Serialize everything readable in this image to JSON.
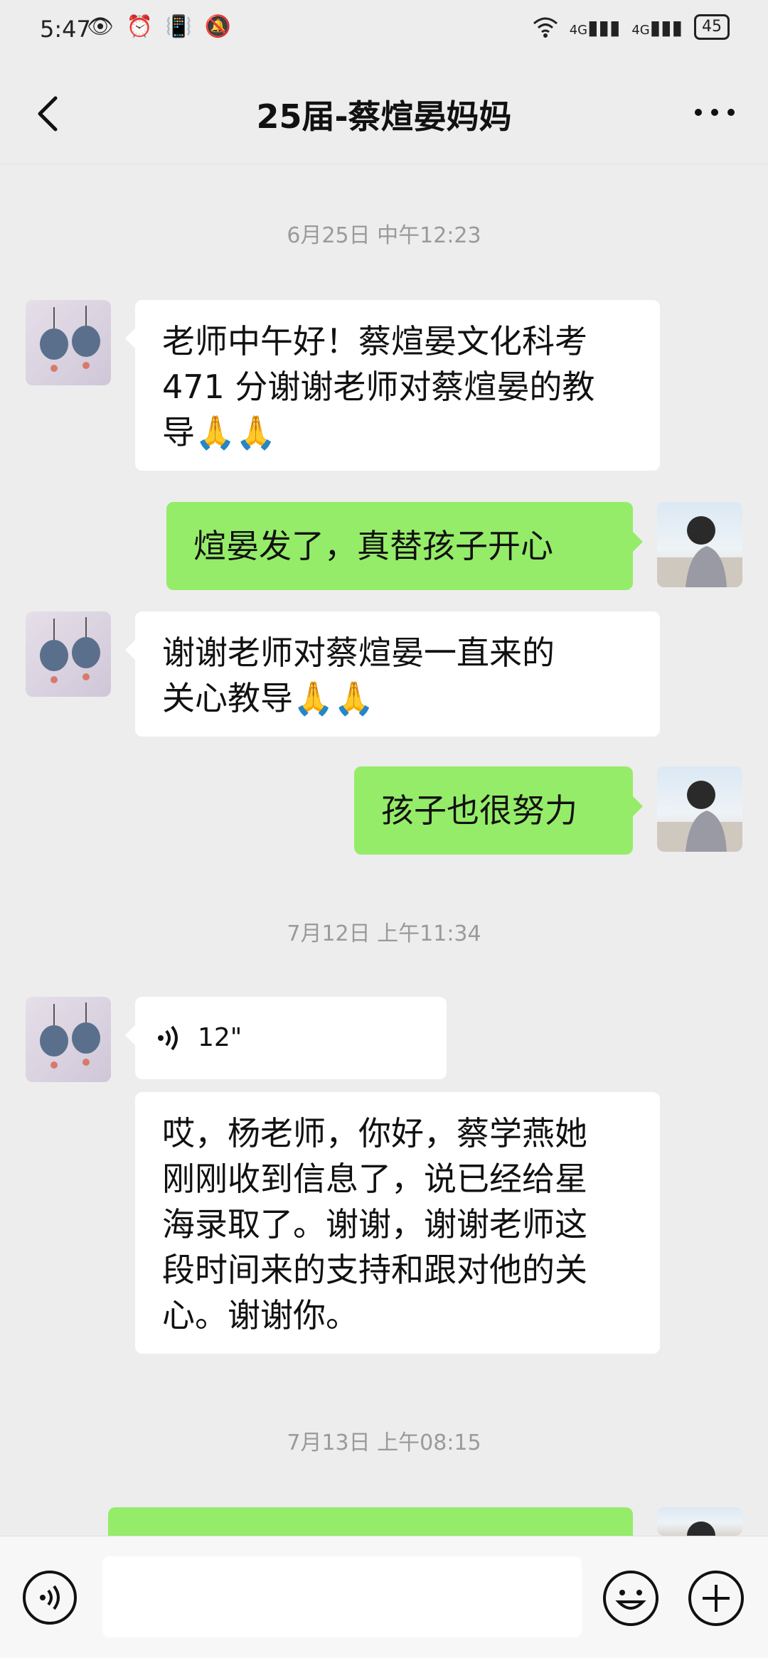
{
  "status_bar": {
    "time": "5:47",
    "left_icons": [
      "eye-icon",
      "alarm-icon",
      "vibrate-icon",
      "mute-icon"
    ],
    "right_icons": [
      "wifi-icon",
      "signal-4g-icon",
      "signal-4g-icon"
    ],
    "network_1": "4G",
    "network_2": "4G",
    "battery": "45"
  },
  "header": {
    "title": "25届-蔡煊晏妈妈",
    "back_icon": "chevron-left-icon",
    "more_icon": "more-icon"
  },
  "messages": {
    "ts1": "6月25日 中午12:23",
    "m1_line1": "老师中午好！蔡煊晏文化科考",
    "m1_line2": "471 分谢谢老师对蔡煊晏的教",
    "m1_line3": "导🙏🙏",
    "m2": "煊晏发了，真替孩子开心",
    "m3_line1": "谢谢老师对蔡煊晏一直来的",
    "m3_line2": "关心教导🙏🙏",
    "m4": "孩子也很努力",
    "ts2": "7月12日 上午11:34",
    "voice_duration": "12\"",
    "m6_line1": "哎，杨老师，你好，蔡学燕她",
    "m6_line2": "刚刚收到信息了，说已经给星",
    "m6_line3": "海录取了。谢谢，谢谢老师这",
    "m6_line4": "段时间来的支持和跟对他的关",
    "m6_line5": "心。谢谢你。",
    "ts3": "7月13日 上午08:15"
  },
  "input_bar": {
    "voice_icon": "voice-icon",
    "emoji_icon": "emoji-icon",
    "plus_icon": "plus-icon",
    "placeholder": ""
  },
  "colors": {
    "background": "#ededed",
    "bubble_self": "#95ec69",
    "bubble_other": "#ffffff",
    "timestamp": "#9a9a9a"
  }
}
